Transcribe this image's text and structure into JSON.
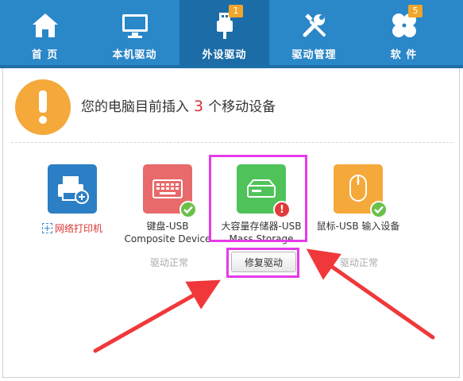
{
  "nav": {
    "items": [
      {
        "label": "首 页",
        "icon": "home-icon",
        "badge": ""
      },
      {
        "label": "本机驱动",
        "icon": "monitor-icon",
        "badge": ""
      },
      {
        "label": "外设驱动",
        "icon": "usb-icon",
        "badge": "1"
      },
      {
        "label": "驱动管理",
        "icon": "tools-icon",
        "badge": ""
      },
      {
        "label": "软 件",
        "icon": "clover-icon",
        "badge": "5"
      }
    ],
    "active_index": 2
  },
  "header": {
    "text_before": "您的电脑目前插入",
    "count": "3",
    "text_after": "个移动设备"
  },
  "devices": [
    {
      "name": "网络打印机",
      "status": "",
      "icon": "printer-icon",
      "color": "#2c7fc4"
    },
    {
      "name_line1": "键盘-USB",
      "name_line2": "Composite Device",
      "status": "驱动正常",
      "icon": "keyboard-icon",
      "color": "#e86a6a"
    },
    {
      "name_line1": "大容量存储器-USB",
      "name_line2": "Mass Storage",
      "status": "",
      "icon": "storage-icon",
      "color": "#4fc35a"
    },
    {
      "name_line1": "鼠标-USB 输入设备",
      "status": "驱动正常",
      "icon": "mouse-icon",
      "color": "#f4a93a"
    }
  ],
  "repair_button": {
    "label": "修复驱动"
  },
  "colors": {
    "nav_bg": "#2a87c8",
    "highlight": "#e53bea",
    "arrow": "#f0383a"
  }
}
